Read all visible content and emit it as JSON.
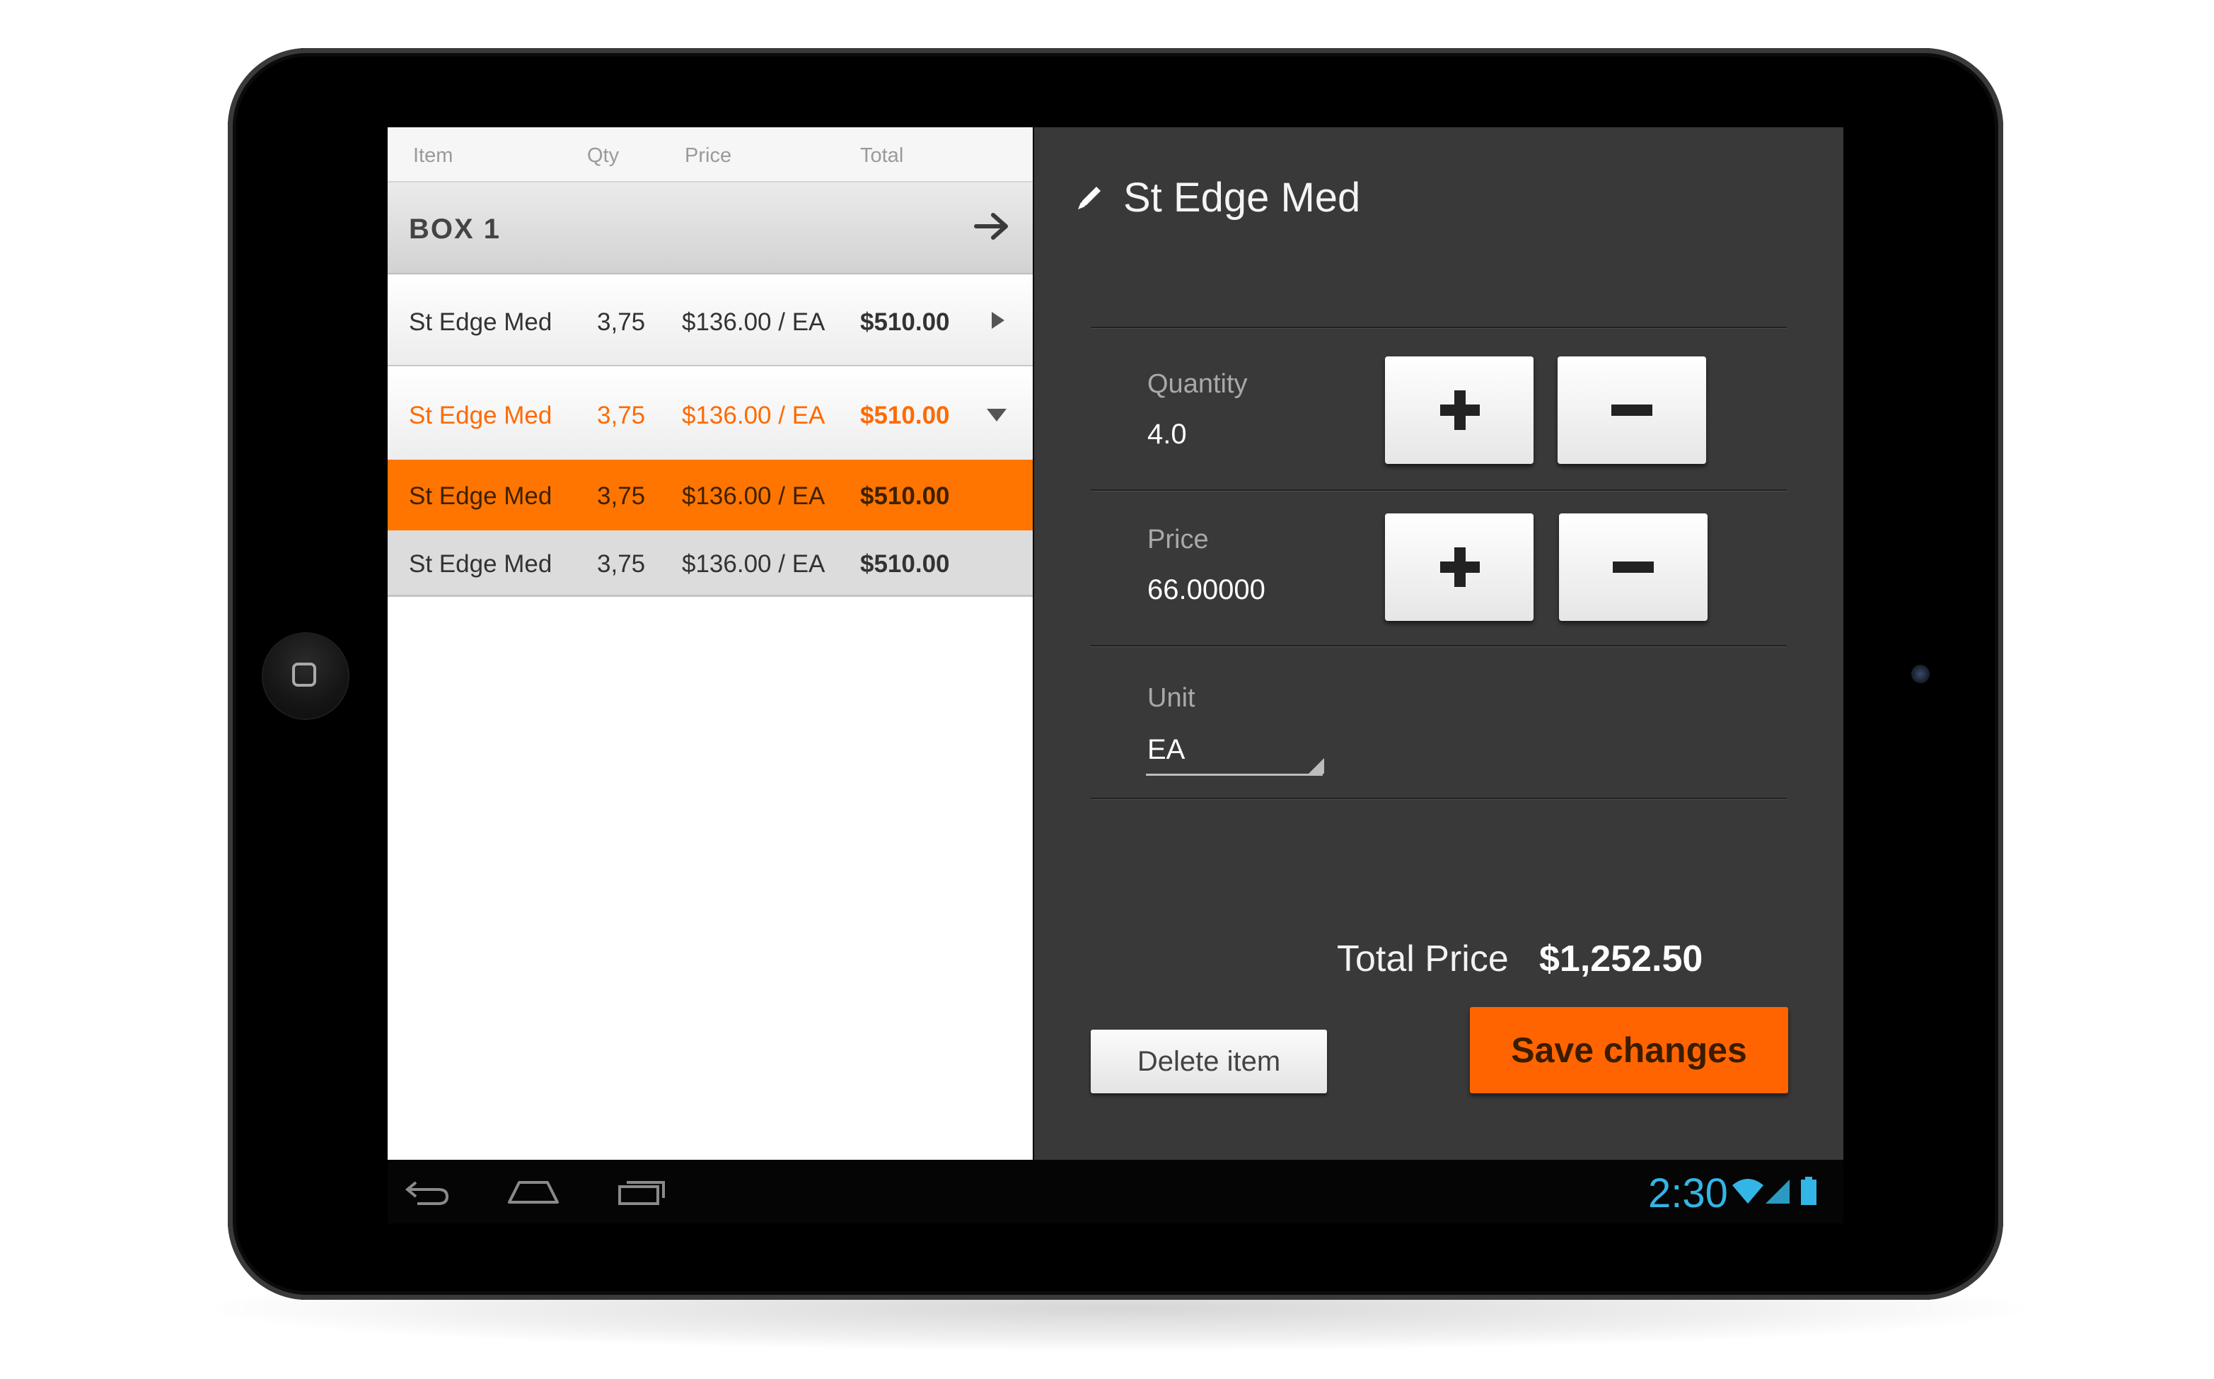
{
  "table": {
    "columns": [
      "Item",
      "Qty",
      "Price",
      "Total"
    ],
    "group": {
      "label": "BOX 1"
    },
    "rows": [
      {
        "item": "St Edge Med",
        "qty": "3,75",
        "price": "$136.00 / EA",
        "total": "$510.00",
        "state": "collapsed"
      },
      {
        "item": "St Edge Med",
        "qty": "3,75",
        "price": "$136.00 / EA",
        "total": "$510.00",
        "state": "expanded"
      },
      {
        "item": "St Edge Med",
        "qty": "3,75",
        "price": "$136.00 / EA",
        "total": "$510.00",
        "state": "selected"
      },
      {
        "item": "St Edge Med",
        "qty": "3,75",
        "price": "$136.00 / EA",
        "total": "$510.00",
        "state": "normal"
      }
    ]
  },
  "editor": {
    "title": "St Edge Med",
    "quantity": {
      "label": "Quantity",
      "value": "4.0"
    },
    "price": {
      "label": "Price",
      "value": "66.00000"
    },
    "unit": {
      "label": "Unit",
      "value": "EA"
    },
    "total_label": "Total Price",
    "total_value": "$1,252.50",
    "delete_label": "Delete item",
    "save_label": "Save changes"
  },
  "status_bar": {
    "time": "2:30"
  },
  "colors": {
    "accent": "#ff6a00",
    "panel": "#393939",
    "clock": "#33b5e5"
  },
  "icons": [
    "pencil-icon",
    "arrow-right-icon",
    "caret-right-icon",
    "caret-down-icon",
    "plus-icon",
    "minus-icon",
    "back-icon",
    "home-icon",
    "recent-apps-icon",
    "wifi-icon",
    "signal-icon",
    "battery-icon"
  ]
}
